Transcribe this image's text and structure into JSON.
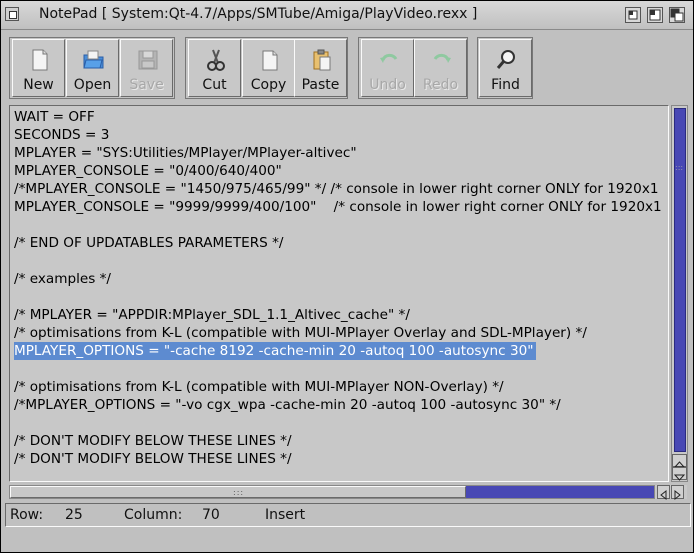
{
  "window": {
    "title": "NotePad [ System:Qt-4.7/Apps/SMTube/Amiga/PlayVideo.rexx ]"
  },
  "toolbar": {
    "new": "New",
    "open": "Open",
    "save": "Save",
    "cut": "Cut",
    "copy": "Copy",
    "paste": "Paste",
    "undo": "Undo",
    "redo": "Redo",
    "find": "Find"
  },
  "editor": {
    "lines": [
      "WAIT = OFF",
      "SECONDS = 3",
      "MPLAYER = \"SYS:Utilities/MPlayer/MPlayer-altivec\"",
      "MPLAYER_CONSOLE = \"0/400/640/400\"",
      "/*MPLAYER_CONSOLE = \"1450/975/465/99\" */ /* console in lower right corner ONLY for 1920x1",
      "MPLAYER_CONSOLE = \"9999/9999/400/100\"    /* console in lower right corner ONLY for 1920x1",
      "",
      "/* END OF UPDATABLES PARAMETERS */",
      "",
      "/* examples */",
      "",
      "/* MPLAYER = \"APPDIR:MPlayer_SDL_1.1_Altivec_cache\" */",
      "/* optimisations from K-L (compatible with MUI-MPlayer Overlay and SDL-MPlayer) */",
      "MPLAYER_OPTIONS = \"-cache 8192 -cache-min 20 -autoq 100 -autosync 30\"",
      "",
      "/* optimisations from K-L (compatible with MUI-MPlayer NON-Overlay) */",
      "/*MPLAYER_OPTIONS = \"-vo cgx_wpa -cache-min 20 -autoq 100 -autosync 30\" */",
      "",
      "/* DON'T MODIFY BELOW THESE LINES */",
      "/* DON'T MODIFY BELOW THESE LINES */"
    ],
    "selected_line_index": 13
  },
  "status": {
    "row_label": "Row:",
    "row_value": "25",
    "column_label": "Column:",
    "column_value": "70",
    "mode": "Insert"
  },
  "colors": {
    "selection": "#5d8bd0",
    "scrollbar": "#4848b4"
  }
}
